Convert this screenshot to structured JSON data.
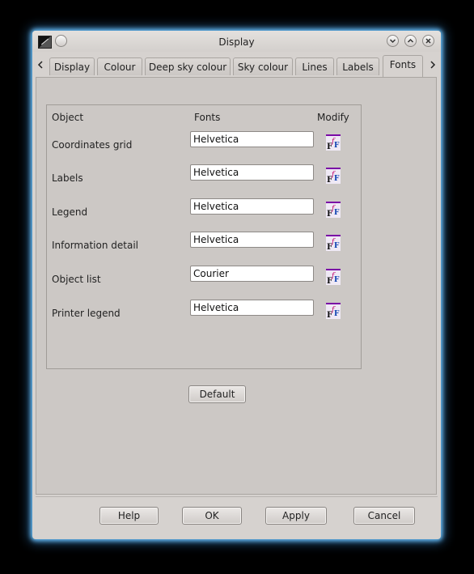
{
  "window": {
    "title": "Display"
  },
  "tabs": [
    {
      "label": "Display",
      "active": false
    },
    {
      "label": "Colour",
      "active": false
    },
    {
      "label": "Deep sky colour",
      "active": false
    },
    {
      "label": "Sky colour",
      "active": false
    },
    {
      "label": "Lines",
      "active": false
    },
    {
      "label": "Labels",
      "active": false
    },
    {
      "label": "Fonts",
      "active": true
    }
  ],
  "fonts_table": {
    "headers": {
      "object": "Object",
      "fonts": "Fonts",
      "modify": "Modify"
    },
    "rows": [
      {
        "object": "Coordinates grid",
        "font": "Helvetica"
      },
      {
        "object": "Labels",
        "font": "Helvetica"
      },
      {
        "object": "Legend",
        "font": "Helvetica"
      },
      {
        "object": "Information detail",
        "font": "Helvetica"
      },
      {
        "object": "Object list",
        "font": "Courier"
      },
      {
        "object": "Printer legend",
        "font": "Helvetica"
      }
    ]
  },
  "buttons": {
    "default": "Default",
    "help": "Help",
    "ok": "OK",
    "apply": "Apply",
    "cancel": "Cancel"
  },
  "icons": {
    "modify": "font-select-icon",
    "tab_prev": "chevron-left-icon",
    "tab_next": "chevron-right-icon"
  },
  "colors": {
    "glow": "#6fc6ff",
    "window_bg": "#d6d2cf"
  }
}
